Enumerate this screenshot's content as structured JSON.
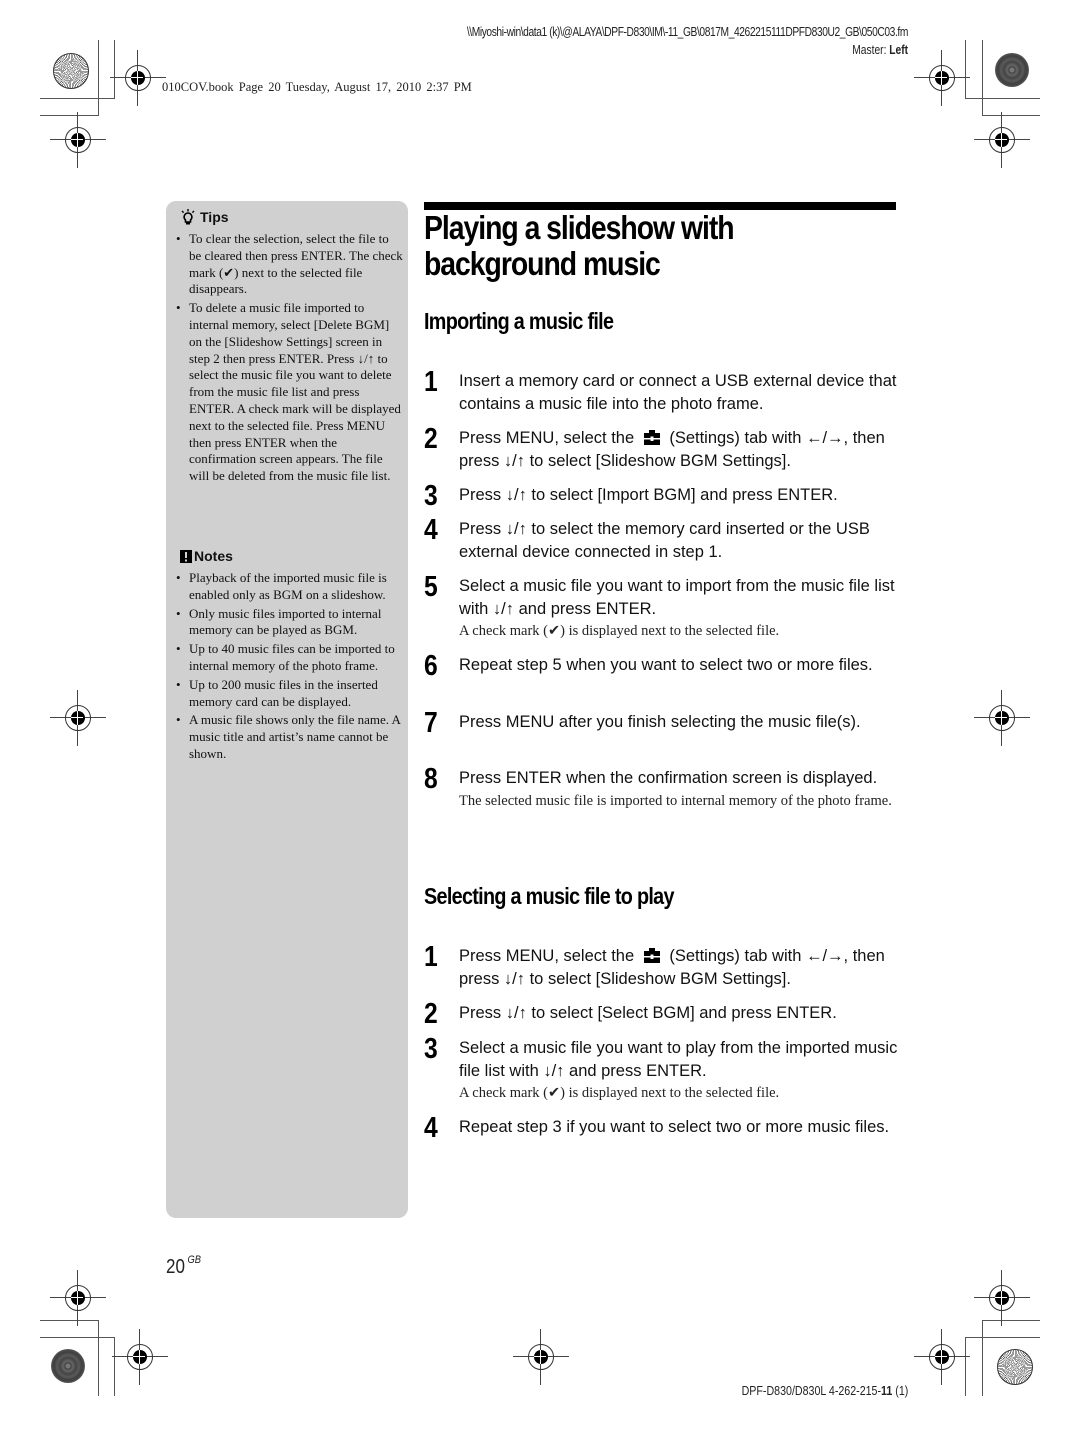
{
  "header": {
    "file_path": "\\\\Miyoshi-win\\data1 (k)\\@ALAYA\\DPF-D830\\IM\\-11_GB\\0817M_4262215111DPFD830U2_GB\\050C03.fm",
    "master_label": "Master:",
    "master_value": "Left",
    "book_line": "010COV.book  Page 20  Tuesday, August 17, 2010  2:37 PM"
  },
  "sidebar": {
    "tips": {
      "icon": "lightbulb-icon",
      "heading": "Tips",
      "items": [
        "To clear the selection, select the file to be cleared then press ENTER. The check mark (✔) next to the selected file disappears.",
        "To delete a music file imported to internal memory, select [Delete BGM] on the [Slideshow Settings] screen in step 2 then press ENTER. Press ↓/↑ to select the music file you want to delete from the music file list and press ENTER. A check mark will be displayed next to the selected file. Press MENU then press ENTER when the confirmation screen appears. The file will be deleted from the music file list."
      ]
    },
    "notes": {
      "icon": "note-icon",
      "heading": "Notes",
      "items": [
        "Playback of the imported music file is enabled only as BGM on a slideshow.",
        "Only music files imported to internal memory can be played as BGM.",
        "Up to 40 music files can be imported to internal memory of the photo frame.",
        "Up to 200 music files in the inserted memory card can be displayed.",
        "A music file shows only the file name. A music title and artist’s name cannot be shown."
      ]
    }
  },
  "main": {
    "title_line1": "Playing a slideshow with",
    "title_line2": "background music",
    "sections": [
      {
        "heading": "Importing a music file",
        "steps": [
          {
            "num": "1",
            "text": "Insert a memory card or connect a USB external device that contains a music file into the photo frame.",
            "note": ""
          },
          {
            "num": "2",
            "text_a": "Press MENU, select the",
            "icon": "settings-toolbox-icon",
            "text_b": "(Settings) tab with ←/→, then press ↓/↑ to select [Slideshow BGM Settings].",
            "note": ""
          },
          {
            "num": "3",
            "text": "Press ↓/↑ to select [Import BGM] and press ENTER.",
            "note": ""
          },
          {
            "num": "4",
            "text": "Press ↓/↑ to select the memory card inserted or the USB external device connected in step 1.",
            "note": ""
          },
          {
            "num": "5",
            "text": "Select a music file you want to import from the music file list with ↓/↑ and press ENTER.",
            "note": "A check mark (✔) is displayed next to the selected file."
          },
          {
            "num": "6",
            "text": "Repeat step 5 when you want to select two or more files.",
            "note": ""
          },
          {
            "num": "7",
            "text": "Press MENU after you finish selecting the music file(s).",
            "note": ""
          },
          {
            "num": "8",
            "text": "Press ENTER when the confirmation screen is displayed.",
            "note": "The selected music file is imported to internal memory of the photo frame."
          }
        ]
      },
      {
        "heading": "Selecting a music file to play",
        "steps": [
          {
            "num": "1",
            "text_a": "Press MENU, select the",
            "icon": "settings-toolbox-icon",
            "text_b": "(Settings) tab with ←/→, then press ↓/↑ to select [Slideshow BGM Settings].",
            "note": ""
          },
          {
            "num": "2",
            "text": "Press ↓/↑ to select [Select BGM] and press ENTER.",
            "note": ""
          },
          {
            "num": "3",
            "text": "Select a music file you want to play from the imported music file list with ↓/↑ and press ENTER.",
            "note": "A check mark (✔) is displayed next to the selected file."
          },
          {
            "num": "4",
            "text": "Repeat step 3 if you want to select two or more music files.",
            "note": ""
          }
        ]
      }
    ]
  },
  "footer": {
    "page_number": "20",
    "page_suffix": "GB",
    "model_prefix": "DPF-D830/D830L 4-262-215-",
    "model_bold": "11",
    "model_suffix": " (1)"
  },
  "colors": {
    "sidebar_bg": "#d0d0d0",
    "title_bar": "#000000"
  }
}
